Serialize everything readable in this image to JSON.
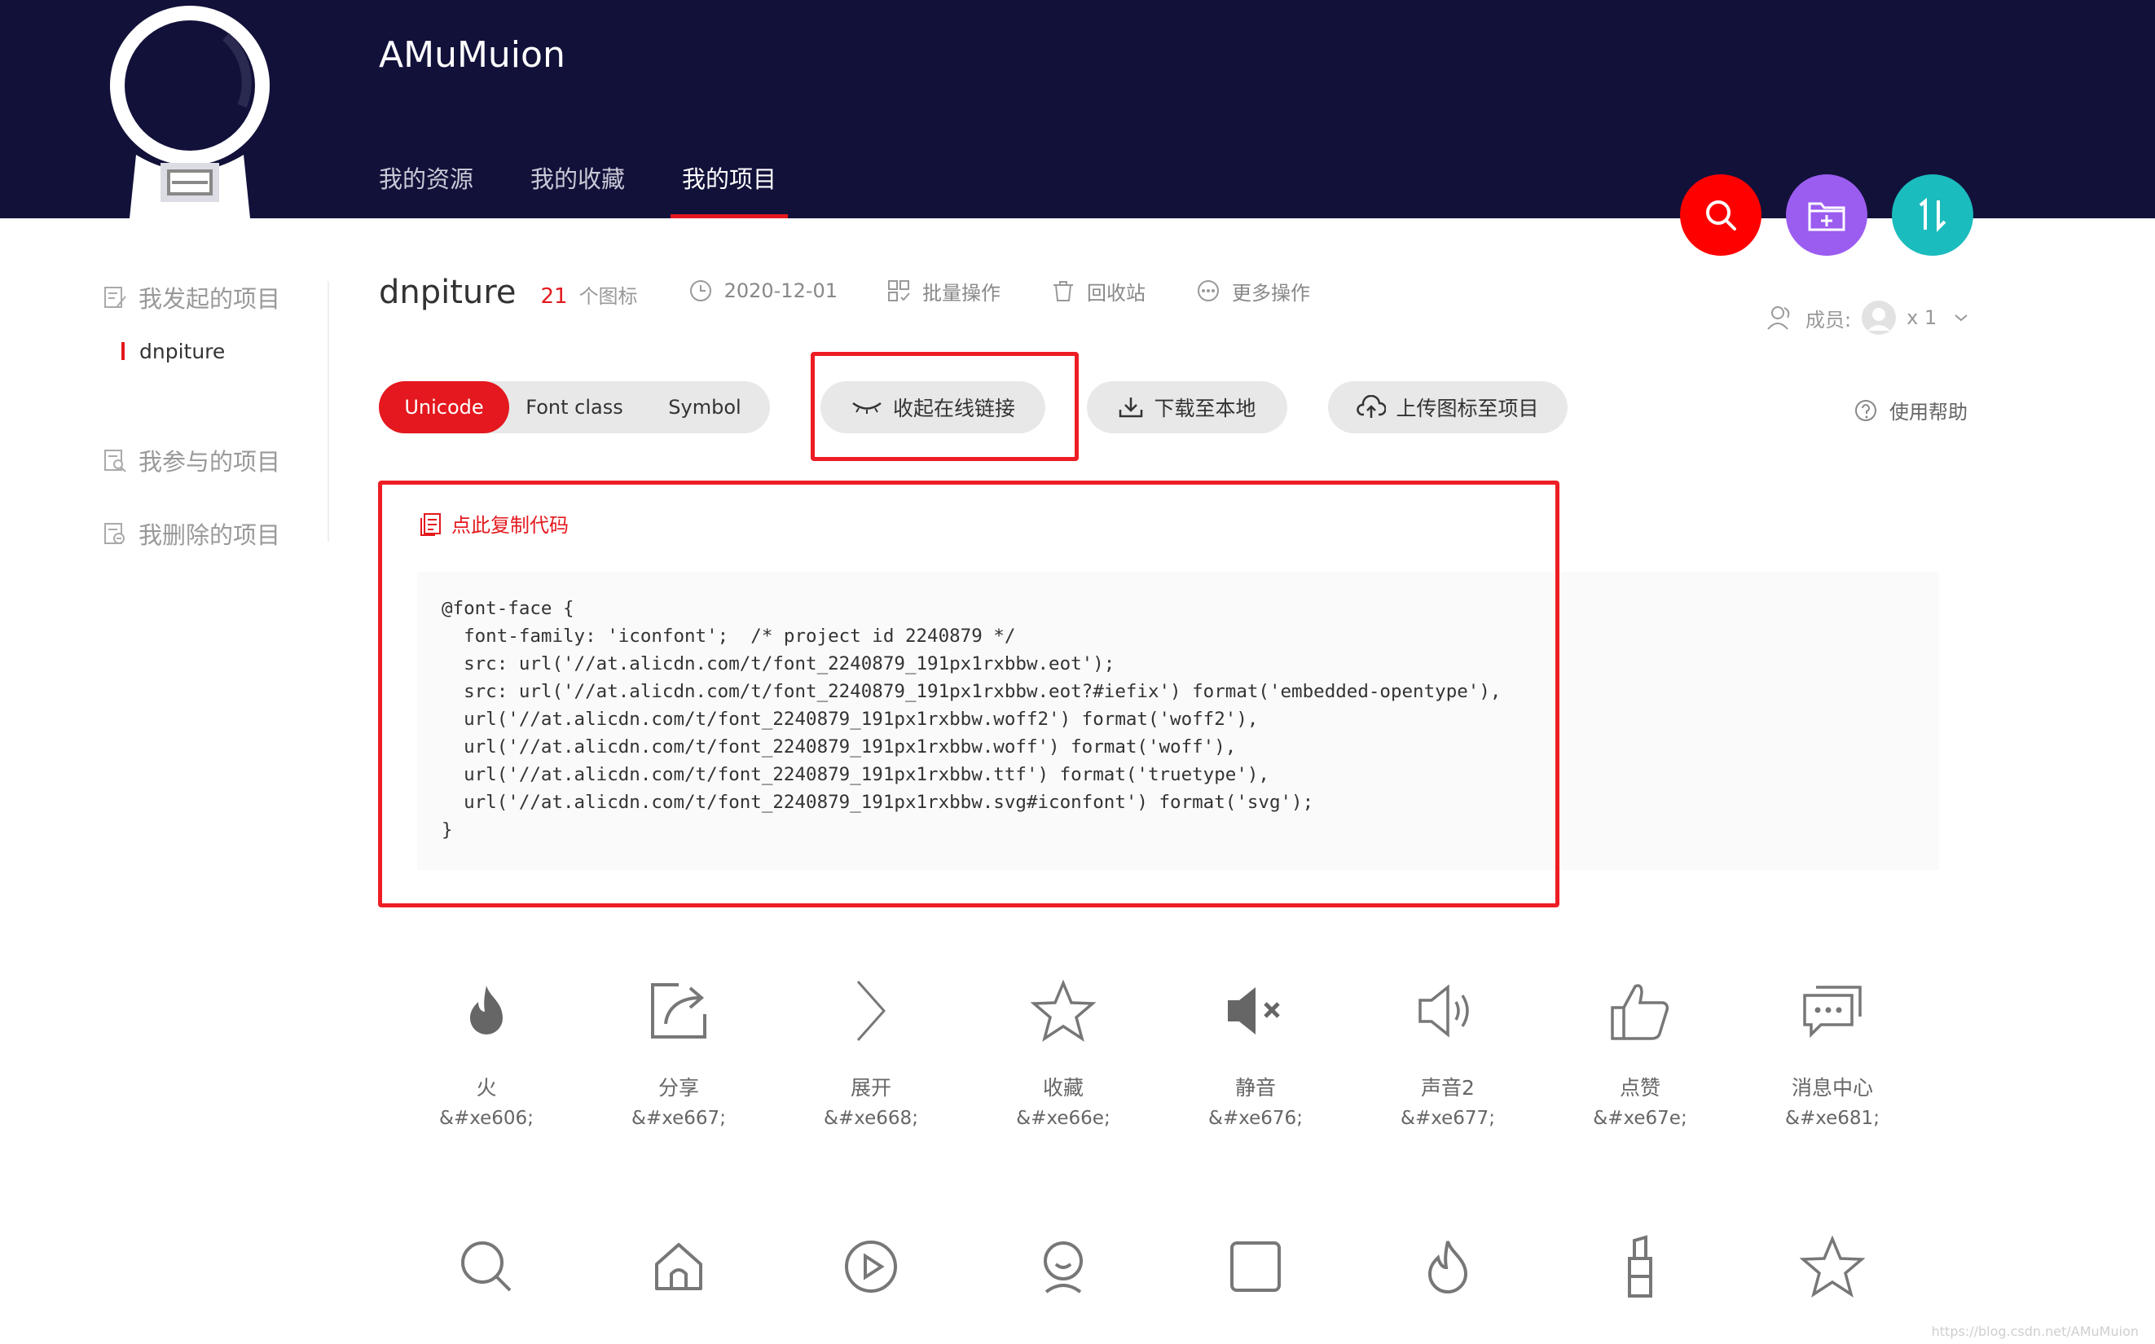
{
  "header": {
    "site_title": "AMuMuion",
    "nav": [
      "我的资源",
      "我的收藏",
      "我的项目"
    ],
    "active_nav": "我的项目",
    "buttons": [
      {
        "name": "search",
        "color": "#ff0000"
      },
      {
        "name": "add-folder",
        "color": "#9b5cf0"
      },
      {
        "name": "sort",
        "color": "#1bbcbd"
      }
    ]
  },
  "sidebar": {
    "my_started": "我发起的项目",
    "sub_project": "dnpiture",
    "my_joined": "我参与的项目",
    "my_deleted": "我删除的项目"
  },
  "project": {
    "name": "dnpiture",
    "count": "21",
    "count_unit": "个图标",
    "date": "2020-12-01",
    "batch_ops": "批量操作",
    "recycle_bin": "回收站",
    "more_ops": "更多操作",
    "members_label": "成员:",
    "members_count": "x 1"
  },
  "tabs": {
    "items": [
      "Unicode",
      "Font class",
      "Symbol"
    ],
    "active": "Unicode"
  },
  "actions": {
    "collapse_link": "收起在线链接",
    "download": "下载至本地",
    "upload": "上传图标至项目",
    "help": "使用帮助"
  },
  "code_panel": {
    "copy_label": "点此复制代码",
    "code": "@font-face {\n  font-family: 'iconfont';  /* project id 2240879 */\n  src: url('//at.alicdn.com/t/font_2240879_191px1rxbbw.eot');\n  src: url('//at.alicdn.com/t/font_2240879_191px1rxbbw.eot?#iefix') format('embedded-opentype'),\n  url('//at.alicdn.com/t/font_2240879_191px1rxbbw.woff2') format('woff2'),\n  url('//at.alicdn.com/t/font_2240879_191px1rxbbw.woff') format('woff'),\n  url('//at.alicdn.com/t/font_2240879_191px1rxbbw.ttf') format('truetype'),\n  url('//at.alicdn.com/t/font_2240879_191px1rxbbw.svg#iconfont') format('svg');\n}"
  },
  "icons": [
    {
      "icon": "fire-icon",
      "name": "火",
      "code": "&#xe606;"
    },
    {
      "icon": "share-icon",
      "name": "分享",
      "code": "&#xe667;"
    },
    {
      "icon": "chevron-right-icon",
      "name": "展开",
      "code": "&#xe668;"
    },
    {
      "icon": "star-icon",
      "name": "收藏",
      "code": "&#xe66e;"
    },
    {
      "icon": "mute-icon",
      "name": "静音",
      "code": "&#xe676;"
    },
    {
      "icon": "sound-icon",
      "name": "声音2",
      "code": "&#xe677;"
    },
    {
      "icon": "thumbs-up-icon",
      "name": "点赞",
      "code": "&#xe67e;"
    },
    {
      "icon": "message-icon",
      "name": "消息中心",
      "code": "&#xe681;"
    }
  ],
  "icons_row2": [
    "search-icon",
    "home-icon",
    "play-icon",
    "user-icon",
    "square-icon",
    "flame-icon",
    "lipstick-icon",
    "star-outline-icon"
  ],
  "watermark": "https://blog.csdn.net/AMuMuion"
}
